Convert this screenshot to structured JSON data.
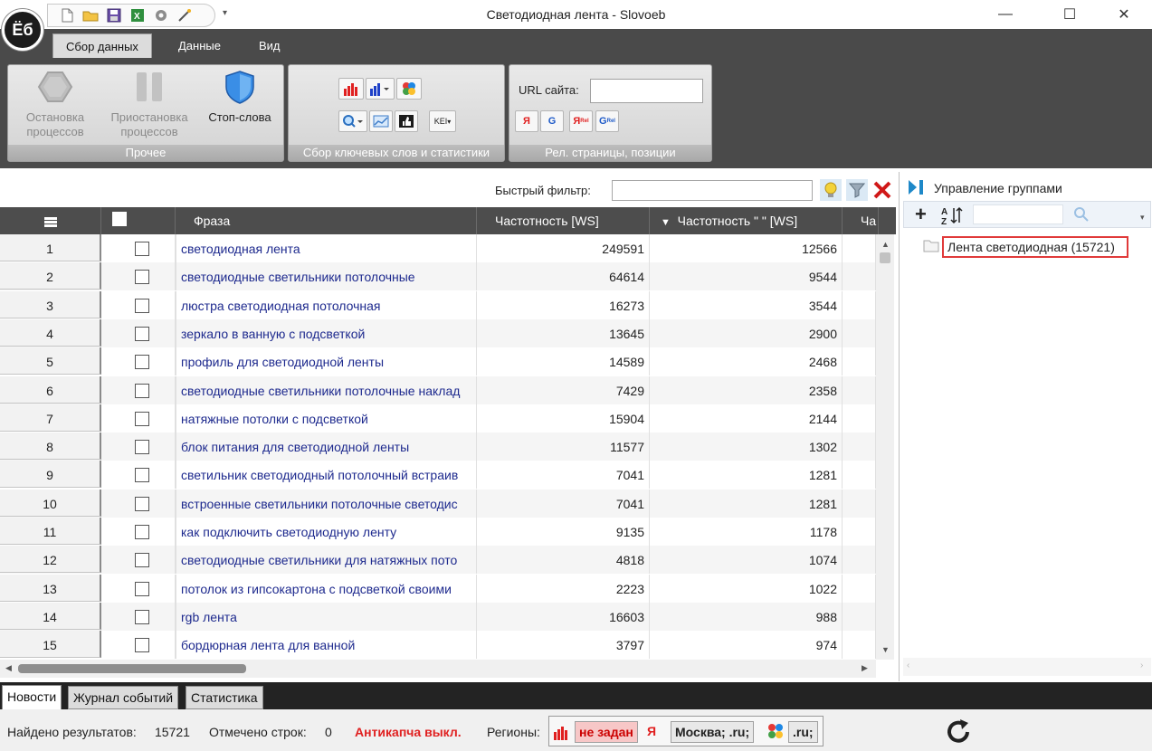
{
  "app": {
    "logo": "Ёб",
    "title": "Светодиодная лента - Slovoeb",
    "quick_access_icons": [
      "new-file-icon",
      "open-folder-icon",
      "save-icon",
      "excel-export-icon",
      "settings-gear-icon",
      "magic-wand-icon"
    ]
  },
  "ribbon": {
    "tabs": [
      "Сбор данных",
      "Данные",
      "Вид"
    ],
    "active_tab": 0,
    "groups": {
      "other": {
        "label": "Прочее",
        "stop": "Остановка\nпроцессов",
        "pause": "Приостановка\nпроцессов",
        "stopwords": "Стоп-слова"
      },
      "collect": {
        "label": "Сбор ключевых слов и статистики",
        "kei": "KEI"
      },
      "positions": {
        "label": "Рел. страницы, позиции",
        "url_label": "URL сайта:",
        "url_value": ""
      }
    }
  },
  "filter": {
    "label": "Быстрый фильтр:",
    "value": ""
  },
  "grid": {
    "columns": [
      "Фраза",
      "Частотность [WS]",
      "Частотность \" \" [WS]",
      "Ча"
    ],
    "rows": [
      {
        "n": "1",
        "phrase": "светодиодная лента",
        "ws": "249591",
        "ws_quoted": "12566"
      },
      {
        "n": "2",
        "phrase": "светодиодные светильники потолочные",
        "ws": "64614",
        "ws_quoted": "9544"
      },
      {
        "n": "3",
        "phrase": "люстра светодиодная потолочная",
        "ws": "16273",
        "ws_quoted": "3544"
      },
      {
        "n": "4",
        "phrase": "зеркало в ванную с подсветкой",
        "ws": "13645",
        "ws_quoted": "2900"
      },
      {
        "n": "5",
        "phrase": "профиль для светодиодной ленты",
        "ws": "14589",
        "ws_quoted": "2468"
      },
      {
        "n": "6",
        "phrase": "светодиодные светильники потолочные наклад",
        "ws": "7429",
        "ws_quoted": "2358"
      },
      {
        "n": "7",
        "phrase": "натяжные потолки с подсветкой",
        "ws": "15904",
        "ws_quoted": "2144"
      },
      {
        "n": "8",
        "phrase": "блок питания для светодиодной ленты",
        "ws": "11577",
        "ws_quoted": "1302"
      },
      {
        "n": "9",
        "phrase": "светильник светодиодный потолочный встраив",
        "ws": "7041",
        "ws_quoted": "1281"
      },
      {
        "n": "10",
        "phrase": "встроенные светильники потолочные светодис",
        "ws": "7041",
        "ws_quoted": "1281"
      },
      {
        "n": "11",
        "phrase": "как подключить светодиодную ленту",
        "ws": "9135",
        "ws_quoted": "1178"
      },
      {
        "n": "12",
        "phrase": "светодиодные светильники для натяжных пото",
        "ws": "4818",
        "ws_quoted": "1074"
      },
      {
        "n": "13",
        "phrase": "потолок из гипсокартона с подсветкой своими",
        "ws": "2223",
        "ws_quoted": "1022"
      },
      {
        "n": "14",
        "phrase": "rgb лента",
        "ws": "16603",
        "ws_quoted": "988"
      },
      {
        "n": "15",
        "phrase": "бордюрная лента для ванной",
        "ws": "3797",
        "ws_quoted": "974"
      }
    ]
  },
  "groups_panel": {
    "title": "Управление группами",
    "items": [
      {
        "label": "Лента светодиодная (15721)"
      }
    ]
  },
  "bottom_tabs": [
    "Новости",
    "Журнал событий",
    "Статистика"
  ],
  "status": {
    "found_label": "Найдено результатов:",
    "found_value": "15721",
    "marked_label": "Отмечено строк:",
    "marked_value": "0",
    "anticaptcha": "Антикапча выкл.",
    "regions_label": "Регионы:",
    "region_wordstat": "не задан",
    "region_yandex": "Москва; .ru;",
    "region_google": ".ru;"
  },
  "colors": {
    "accent_red": "#e02020",
    "phrase_blue": "#1e2a8e",
    "dark_chrome": "#4a4a4a"
  }
}
